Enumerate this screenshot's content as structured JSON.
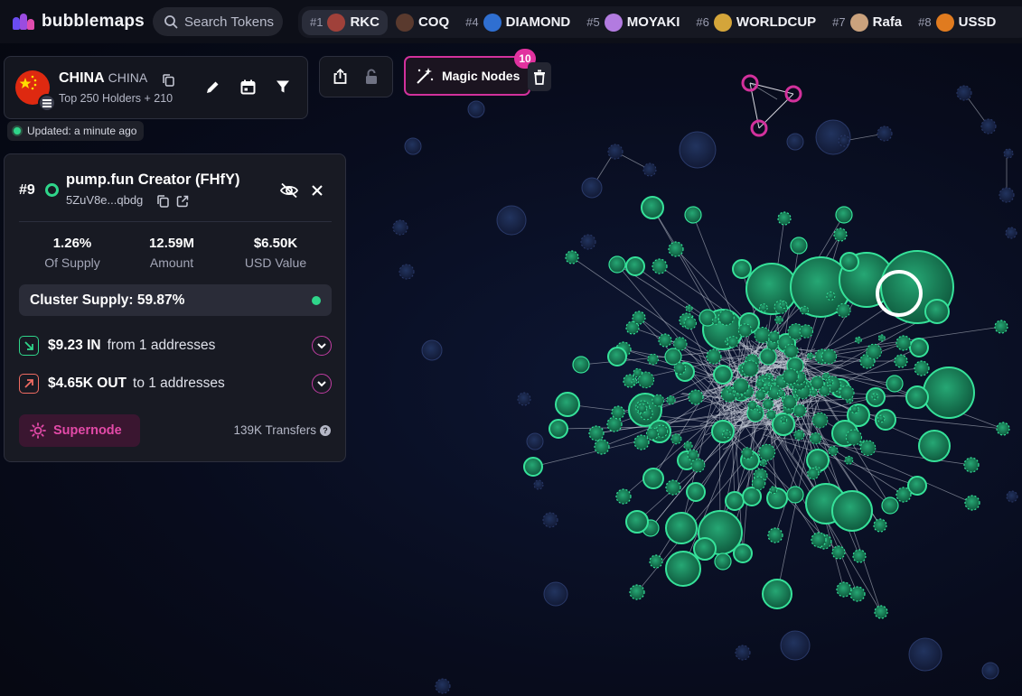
{
  "header": {
    "logo_text": "bubblemaps",
    "search_placeholder": "Search Tokens",
    "trending": [
      {
        "rank": "#1",
        "name": "RKC",
        "icon": "rkc-token-icon",
        "color": "#a0413a",
        "active": true
      },
      {
        "rank": "",
        "name": "COQ",
        "icon": "coq-token-icon",
        "color": "#5a3a2e",
        "active": false
      },
      {
        "rank": "#4",
        "name": "DIAMOND",
        "icon": "diamond-token-icon",
        "color": "#2f6fd1",
        "active": false
      },
      {
        "rank": "#5",
        "name": "MOYAKI",
        "icon": "moyaki-token-icon",
        "color": "#b27be0",
        "active": false
      },
      {
        "rank": "#6",
        "name": "WORLDCUP",
        "icon": "worldcup-token-icon",
        "color": "#d4a53a",
        "active": false
      },
      {
        "rank": "#7",
        "name": "Rafa",
        "icon": "rafa-token-icon",
        "color": "#caa27d",
        "active": false
      },
      {
        "rank": "#8",
        "name": "USSD",
        "icon": "ussd-token-icon",
        "color": "#e07b1f",
        "active": false
      }
    ]
  },
  "token": {
    "name": "CHINA",
    "symbol": "CHINA",
    "subtitle": "Top 250 Holders + 210",
    "updated": "Updated: a minute ago",
    "icons": [
      "copy-icon",
      "edit-icon",
      "calendar-icon",
      "filter-icon",
      "share-icon",
      "lock-icon"
    ]
  },
  "magic_nodes": {
    "label": "Magic Nodes",
    "count": "10"
  },
  "details": {
    "rank": "#9",
    "title": "pump.fun Creator (FHfY)",
    "address": "5ZuV8e...qbdg",
    "stats": [
      {
        "value": "1.26%",
        "label": "Of Supply"
      },
      {
        "value": "12.59M",
        "label": "Amount"
      },
      {
        "value": "$6.50K",
        "label": "USD Value"
      }
    ],
    "cluster_supply": "Cluster Supply: 59.87%",
    "inflow": {
      "amount": "$9.23 IN",
      "text": "from 1 addresses"
    },
    "outflow": {
      "amount": "$4.65K OUT",
      "text": "to 1 addresses"
    },
    "supernode_label": "Supernode",
    "transfers": "139K Transfers"
  },
  "colors": {
    "accent": "#d2319c",
    "cluster_green": "#2fd58a",
    "bubble_blue": "#1a2548"
  }
}
